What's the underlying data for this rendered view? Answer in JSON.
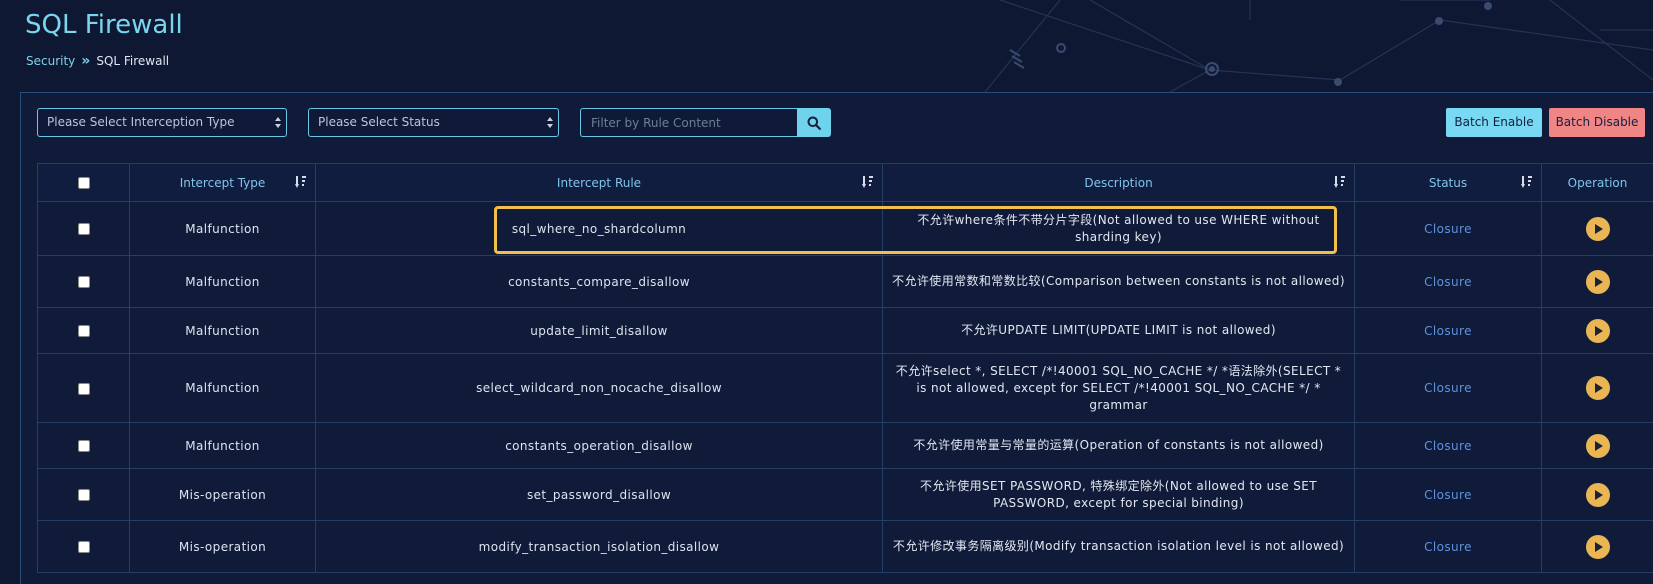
{
  "page": {
    "title": "SQL Firewall"
  },
  "breadcrumb": {
    "parent": "Security",
    "separator": "»",
    "current": "SQL Firewall"
  },
  "filters": {
    "interception_type": "Please Select Interception Type",
    "status": "Please Select Status",
    "rule_content_placeholder": "Filter by Rule Content"
  },
  "actions": {
    "batch_enable": "Batch Enable",
    "batch_disable": "Batch Disable"
  },
  "colors": {
    "accent": "#79d6ee",
    "enable": "#79d8f2",
    "disable": "#f08585",
    "status_link": "#5d93df",
    "play": "#eab653",
    "highlight": "#f0c04a"
  },
  "table": {
    "headers": {
      "intercept_type": "Intercept Type",
      "intercept_rule": "Intercept Rule",
      "description": "Description",
      "status": "Status",
      "operation": "Operation"
    },
    "rows": [
      {
        "type": "Malfunction",
        "rule": "sql_where_no_shardcolumn",
        "description": "不允许where条件不带分片字段(Not allowed to use WHERE without sharding key)",
        "status": "Closure"
      },
      {
        "type": "Malfunction",
        "rule": "constants_compare_disallow",
        "description": "不允许使用常数和常数比较(Comparison between constants is not allowed)",
        "status": "Closure"
      },
      {
        "type": "Malfunction",
        "rule": "update_limit_disallow",
        "description": "不允许UPDATE LIMIT(UPDATE LIMIT is not allowed)",
        "status": "Closure"
      },
      {
        "type": "Malfunction",
        "rule": "select_wildcard_non_nocache_disallow",
        "description": "不允许select *, SELECT /*!40001 SQL_NO_CACHE */ *语法除外(SELECT * is not allowed, except for SELECT /*!40001 SQL_NO_CACHE */ * grammar",
        "status": "Closure"
      },
      {
        "type": "Malfunction",
        "rule": "constants_operation_disallow",
        "description": "不允许使用常量与常量的运算(Operation of constants is not allowed)",
        "status": "Closure"
      },
      {
        "type": "Mis-operation",
        "rule": "set_password_disallow",
        "description": "不允许使用SET PASSWORD, 特殊绑定除外(Not allowed to use SET PASSWORD, except for special binding)",
        "status": "Closure"
      },
      {
        "type": "Mis-operation",
        "rule": "modify_transaction_isolation_disallow",
        "description": "不允许修改事务隔离级别(Modify transaction isolation level is not allowed)",
        "status": "Closure"
      }
    ]
  }
}
